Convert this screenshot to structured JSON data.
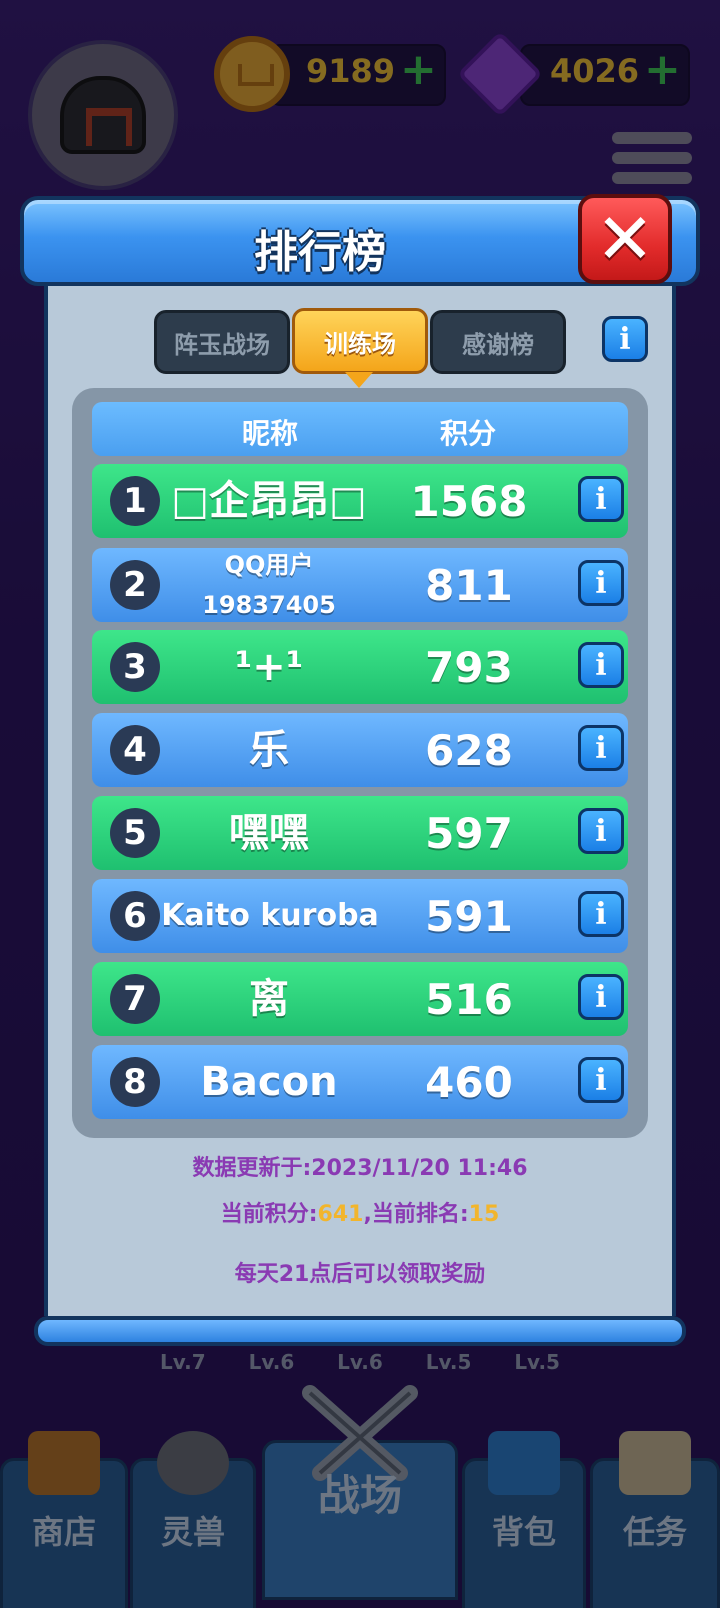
{
  "hud": {
    "coins": "9189",
    "gems": "4026",
    "plus": "+"
  },
  "background": {
    "levels": [
      "Lv.7",
      "Lv.6",
      "Lv.6",
      "Lv.5",
      "Lv.5"
    ]
  },
  "bottom_nav": [
    {
      "label": "商店",
      "active": false
    },
    {
      "label": "灵兽",
      "active": false
    },
    {
      "label": "战场",
      "active": true
    },
    {
      "label": "背包",
      "active": false
    },
    {
      "label": "任务",
      "active": false
    }
  ],
  "modal": {
    "title": "排行榜",
    "close": "✕",
    "tabs": [
      {
        "label": "阵玉战场",
        "active": false
      },
      {
        "label": "训练场",
        "active": true
      },
      {
        "label": "感谢榜",
        "active": false
      }
    ],
    "info": "i",
    "table": {
      "col_name": "昵称",
      "col_score": "积分",
      "rows": [
        {
          "rank": "1",
          "name": "□企昂昂□",
          "score": "1568"
        },
        {
          "rank": "2",
          "name": "QQ用户\n19837405",
          "score": "811"
        },
        {
          "rank": "3",
          "name": "¹+¹",
          "score": "793"
        },
        {
          "rank": "4",
          "name": "乐",
          "score": "628"
        },
        {
          "rank": "5",
          "name": "嘿嘿",
          "score": "597"
        },
        {
          "rank": "6",
          "name": "Kaito kuroba",
          "score": "591"
        },
        {
          "rank": "7",
          "name": "离",
          "score": "516"
        },
        {
          "rank": "8",
          "name": "Bacon",
          "score": "460"
        }
      ]
    },
    "updated": "数据更新于:2023/11/20 11:46",
    "current_score_label": "当前积分:",
    "current_score": "641",
    "current_rank_label": ",当前排名:",
    "current_rank": "15",
    "reward_note": "每天21点后可以领取奖励"
  },
  "colors": {
    "row_green": "#1fc070",
    "row_blue": "#3f8ee8",
    "accent_orange": "#f4a51a",
    "footer_purple": "#8a3ab3"
  }
}
